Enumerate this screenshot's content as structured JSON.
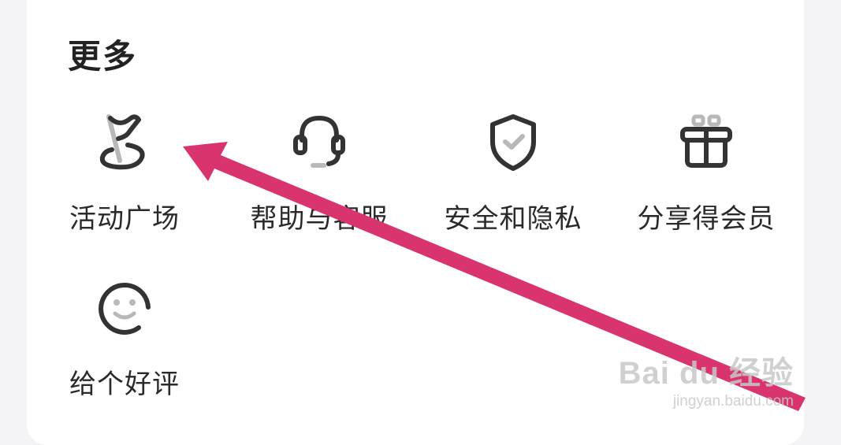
{
  "section": {
    "title": "更多"
  },
  "items": [
    {
      "label": "活动广场",
      "icon": "flag-icon"
    },
    {
      "label": "帮助与客服",
      "icon": "headset-icon"
    },
    {
      "label": "安全和隐私",
      "icon": "shield-check-icon"
    },
    {
      "label": "分享得会员",
      "icon": "gift-icon"
    },
    {
      "label": "给个好评",
      "icon": "smiley-icon"
    }
  ],
  "annotation": {
    "arrow_color": "#d9346f"
  },
  "watermark": {
    "main": "Bai du 经验",
    "sub": "jingyan.baidu.com"
  },
  "colors": {
    "icon_stroke": "#333333",
    "icon_accent": "#b8b8b8",
    "card_bg": "#ffffff",
    "page_bg": "#f4f4f6"
  }
}
